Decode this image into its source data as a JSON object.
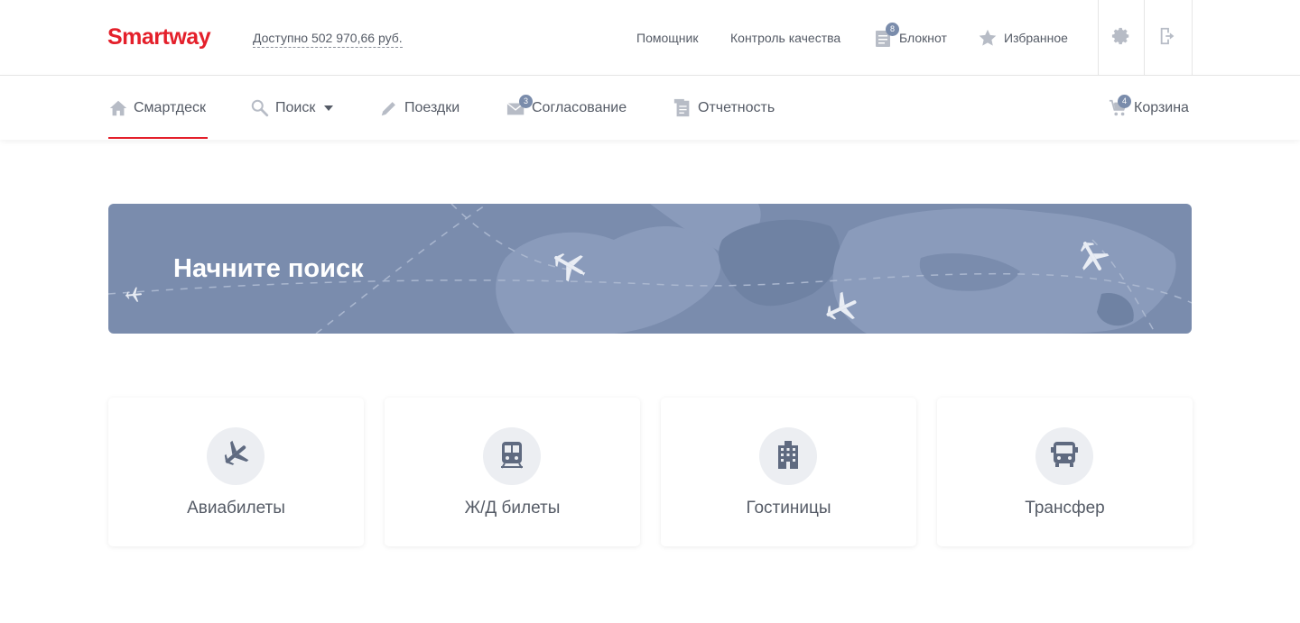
{
  "header": {
    "logo": "Smartway",
    "balance": "Доступно 502 970,66 руб.",
    "links": {
      "assistant": "Помощник",
      "quality": "Контроль качества",
      "notebook": "Блокнот",
      "notebook_badge": "8",
      "favorites": "Избранное"
    },
    "icons": {
      "settings": "gear-icon",
      "logout": "logout-icon"
    }
  },
  "nav": {
    "smartdesk": "Смартдеск",
    "search": "Поиск",
    "trips": "Поездки",
    "approval": "Согласование",
    "approval_badge": "3",
    "reports": "Отчетность",
    "cart": "Корзина",
    "cart_badge": "4"
  },
  "banner": {
    "title": "Начните поиск"
  },
  "cards": [
    {
      "label": "Авиабилеты",
      "icon": "plane-icon"
    },
    {
      "label": "Ж/Д билеты",
      "icon": "train-icon"
    },
    {
      "label": "Гостиницы",
      "icon": "hotel-icon"
    },
    {
      "label": "Трансфер",
      "icon": "bus-icon"
    }
  ],
  "colors": {
    "brand": "#e4202b",
    "banner": "#7a8cad",
    "badge": "#7a8cab",
    "text": "#555b66"
  }
}
